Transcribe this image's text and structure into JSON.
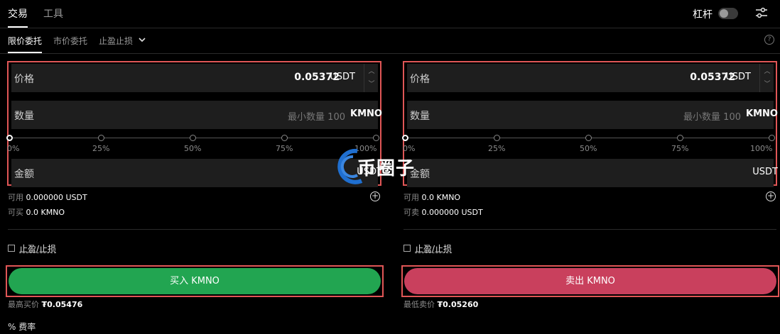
{
  "topbar": {
    "tab_trade": "交易",
    "tab_tools": "工具",
    "leverage_label": "杠杆"
  },
  "subtabs": {
    "limit": "限价委托",
    "market": "市价委托",
    "stop": "止盈止损"
  },
  "buy": {
    "price_label": "价格",
    "price_value": "0.05372",
    "price_unit": "USDT",
    "qty_label": "数量",
    "qty_placeholder": "最小数量 100",
    "qty_unit": "KMNO",
    "slider_percent": 0,
    "ticks": [
      "0%",
      "25%",
      "50%",
      "75%",
      "100%"
    ],
    "amount_label": "金额",
    "amount_unit": "USDT",
    "available_label": "可用",
    "available_value": "0.000000 USDT",
    "can_label": "可买",
    "can_value": "0.0 KMNO",
    "tpsl_label": "止盈/止损",
    "button_label": "买入 KMNO",
    "best_label": "最高买价",
    "best_value": "₮0.05476"
  },
  "sell": {
    "price_label": "价格",
    "price_value": "0.05372",
    "price_unit": "USDT",
    "qty_label": "数量",
    "qty_placeholder": "最小数量 100",
    "qty_unit": "KMNO",
    "slider_percent": 0,
    "ticks": [
      "0%",
      "25%",
      "50%",
      "75%",
      "100%"
    ],
    "amount_label": "金额",
    "amount_unit": "USDT",
    "available_label": "可用",
    "available_value": "0.0 KMNO",
    "can_label": "可卖",
    "can_value": "0.000000 USDT",
    "tpsl_label": "止盈/止损",
    "button_label": "卖出 KMNO",
    "best_label": "最低卖价",
    "best_value": "₮0.05260"
  },
  "fee": {
    "icon": "%",
    "label": "费率"
  },
  "watermark": {
    "text": "币圈子"
  },
  "colors": {
    "buy": "#22a551",
    "sell": "#c9405d",
    "highlight": "#e05656"
  }
}
